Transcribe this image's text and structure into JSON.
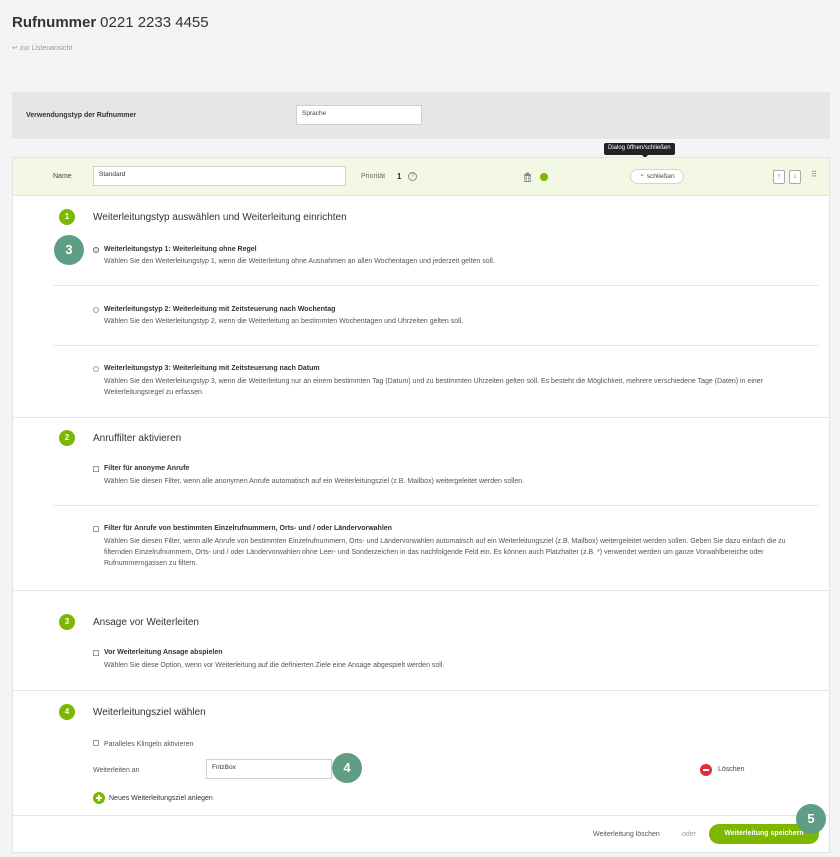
{
  "page": {
    "title_label": "Rufnummer",
    "title_number": "0221 2233 4455",
    "back_link": "zur Listenansicht"
  },
  "usage": {
    "label": "Verwendungstyp der Rufnummer",
    "value": "Sprache"
  },
  "tooltip": "Dialog öffnen/schließen",
  "rule_header": {
    "name_label": "Name",
    "name_value": "Standard",
    "priority_label": "Priorität",
    "priority_value": "1",
    "help_icon": "?",
    "close_label": "schließen",
    "up_arrow": "↑",
    "down_arrow": "↓",
    "drag_handle": "⠿",
    "status_color": "#7cb800"
  },
  "sections": [
    {
      "number": "1",
      "title": "Weiterleitungstyp auswählen und Weiterleitung einrichten",
      "options": [
        {
          "title": "Weiterleitungstyp 1: Weiterleitung ohne Regel",
          "desc": "Wählen Sie den Weiterleitungstyp 1, wenn die Weiterleitung ohne Ausnahmen an allen Wochentagen und jederzeit gelten soll.",
          "selected": true
        },
        {
          "title": "Weiterleitungstyp 2: Weiterleitung mit Zeitsteuerung nach Wochentag",
          "desc": "Wählen Sie den Weiterleitungstyp 2, wenn die Weiterleitung an bestimmten Wochentagen und Uhrzeiten gelten soll.",
          "selected": false
        },
        {
          "title": "Weiterleitungstyp 3: Weiterleitung mit Zeitsteuerung nach Datum",
          "desc": "Wählen Sie den Weiterleitungstyp 3, wenn die Weiterleitung nur an einem bestimmten Tag (Datum) und zu bestimmten Uhrzeiten gelten soll. Es besteht die Möglichkeit, mehrere verschiedene Tage (Daten) in einer Weiterleitungsregel zu erfassen.",
          "selected": false
        }
      ]
    },
    {
      "number": "2",
      "title": "Anruffilter aktivieren",
      "options": [
        {
          "title": "Filter für anonyme Anrufe",
          "desc": "Wählen Sie diesen Filter, wenn alle anonymen Anrufe automatisch auf ein Weiterleitungsziel (z.B. Mailbox) weitergeleitet werden sollen."
        },
        {
          "title": "Filter für Anrufe von bestimmten Einzelrufnummern, Orts- und / oder Ländervorwahlen",
          "desc": "Wählen Sie diesen Filter, wenn alle Anrufe von bestimmten Einzelrufnummern, Orts- und Ländervorwahlen automatisch auf ein Weiterleitungsziel (z.B. Mailbox) weitergeleitet werden sollen. Geben Sie dazu einfach die zu filternden Einzelrufnummern, Orts- und / oder Ländervorwahlen ohne Leer- und Sonderzeichen in das nachfolgende Feld ein. Es können auch Platzhalter (z.B. *) verwendet werden um ganze Vorwahlbereiche oder Rufnummerngassen zu filtern."
        }
      ]
    },
    {
      "number": "3",
      "title": "Ansage vor Weiterleiten",
      "options": [
        {
          "title": "Vor Weiterleitung Ansage abspielen",
          "desc": "Wählen Sie diese Option, wenn vor Weiterleitung auf die definierten Ziele eine Ansage abgespielt werden soll."
        }
      ]
    },
    {
      "number": "4",
      "title": "Weiterleitungsziel wählen",
      "parallel_label": "Paralleles Klingeln aktivieren",
      "forward_label": "Weiterleiten an",
      "forward_value": "FritzBox",
      "delete_label": "Löschen",
      "add_label": "Neues Weiterleitungsziel anlegen"
    }
  ],
  "footer": {
    "delete_label": "Weiterleitung löschen",
    "or_label": "oder",
    "save_label": "Weiterleitung speichern"
  },
  "callouts": [
    "3",
    "4",
    "5"
  ]
}
